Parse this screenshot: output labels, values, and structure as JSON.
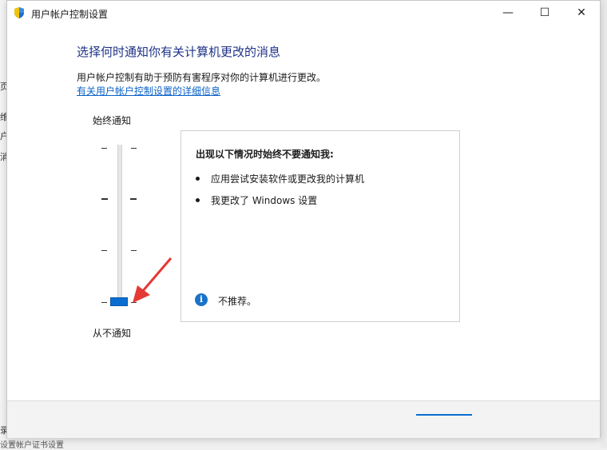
{
  "window": {
    "title": "用户帐户控制设置",
    "controls": {
      "minimize": "—",
      "maximize": "☐",
      "close": "✕"
    }
  },
  "main": {
    "heading": "选择何时通知你有关计算机更改的消息",
    "description": "用户帐户控制有助于预防有害程序对你的计算机进行更改。",
    "link": "有关用户帐户控制设置的详细信息"
  },
  "slider": {
    "top_label": "始终通知",
    "bottom_label": "从不通知",
    "levels": 4,
    "selected_level": 0
  },
  "panel": {
    "title": "出现以下情况时始终不要通知我:",
    "bullets": [
      "应用尝试安装软件或更改我的计算机",
      "我更改了 Windows 设置"
    ],
    "info_icon": "info-icon",
    "info_text": "不推荐。"
  },
  "background": {
    "left_fragments": [
      "页",
      "维",
      "户",
      "消",
      "录",
      "设置帐户证书设置"
    ]
  },
  "colors": {
    "accent": "#0a6ed1",
    "heading": "#1e3287",
    "link": "#0a62c8",
    "annotation_arrow": "#e53935"
  }
}
